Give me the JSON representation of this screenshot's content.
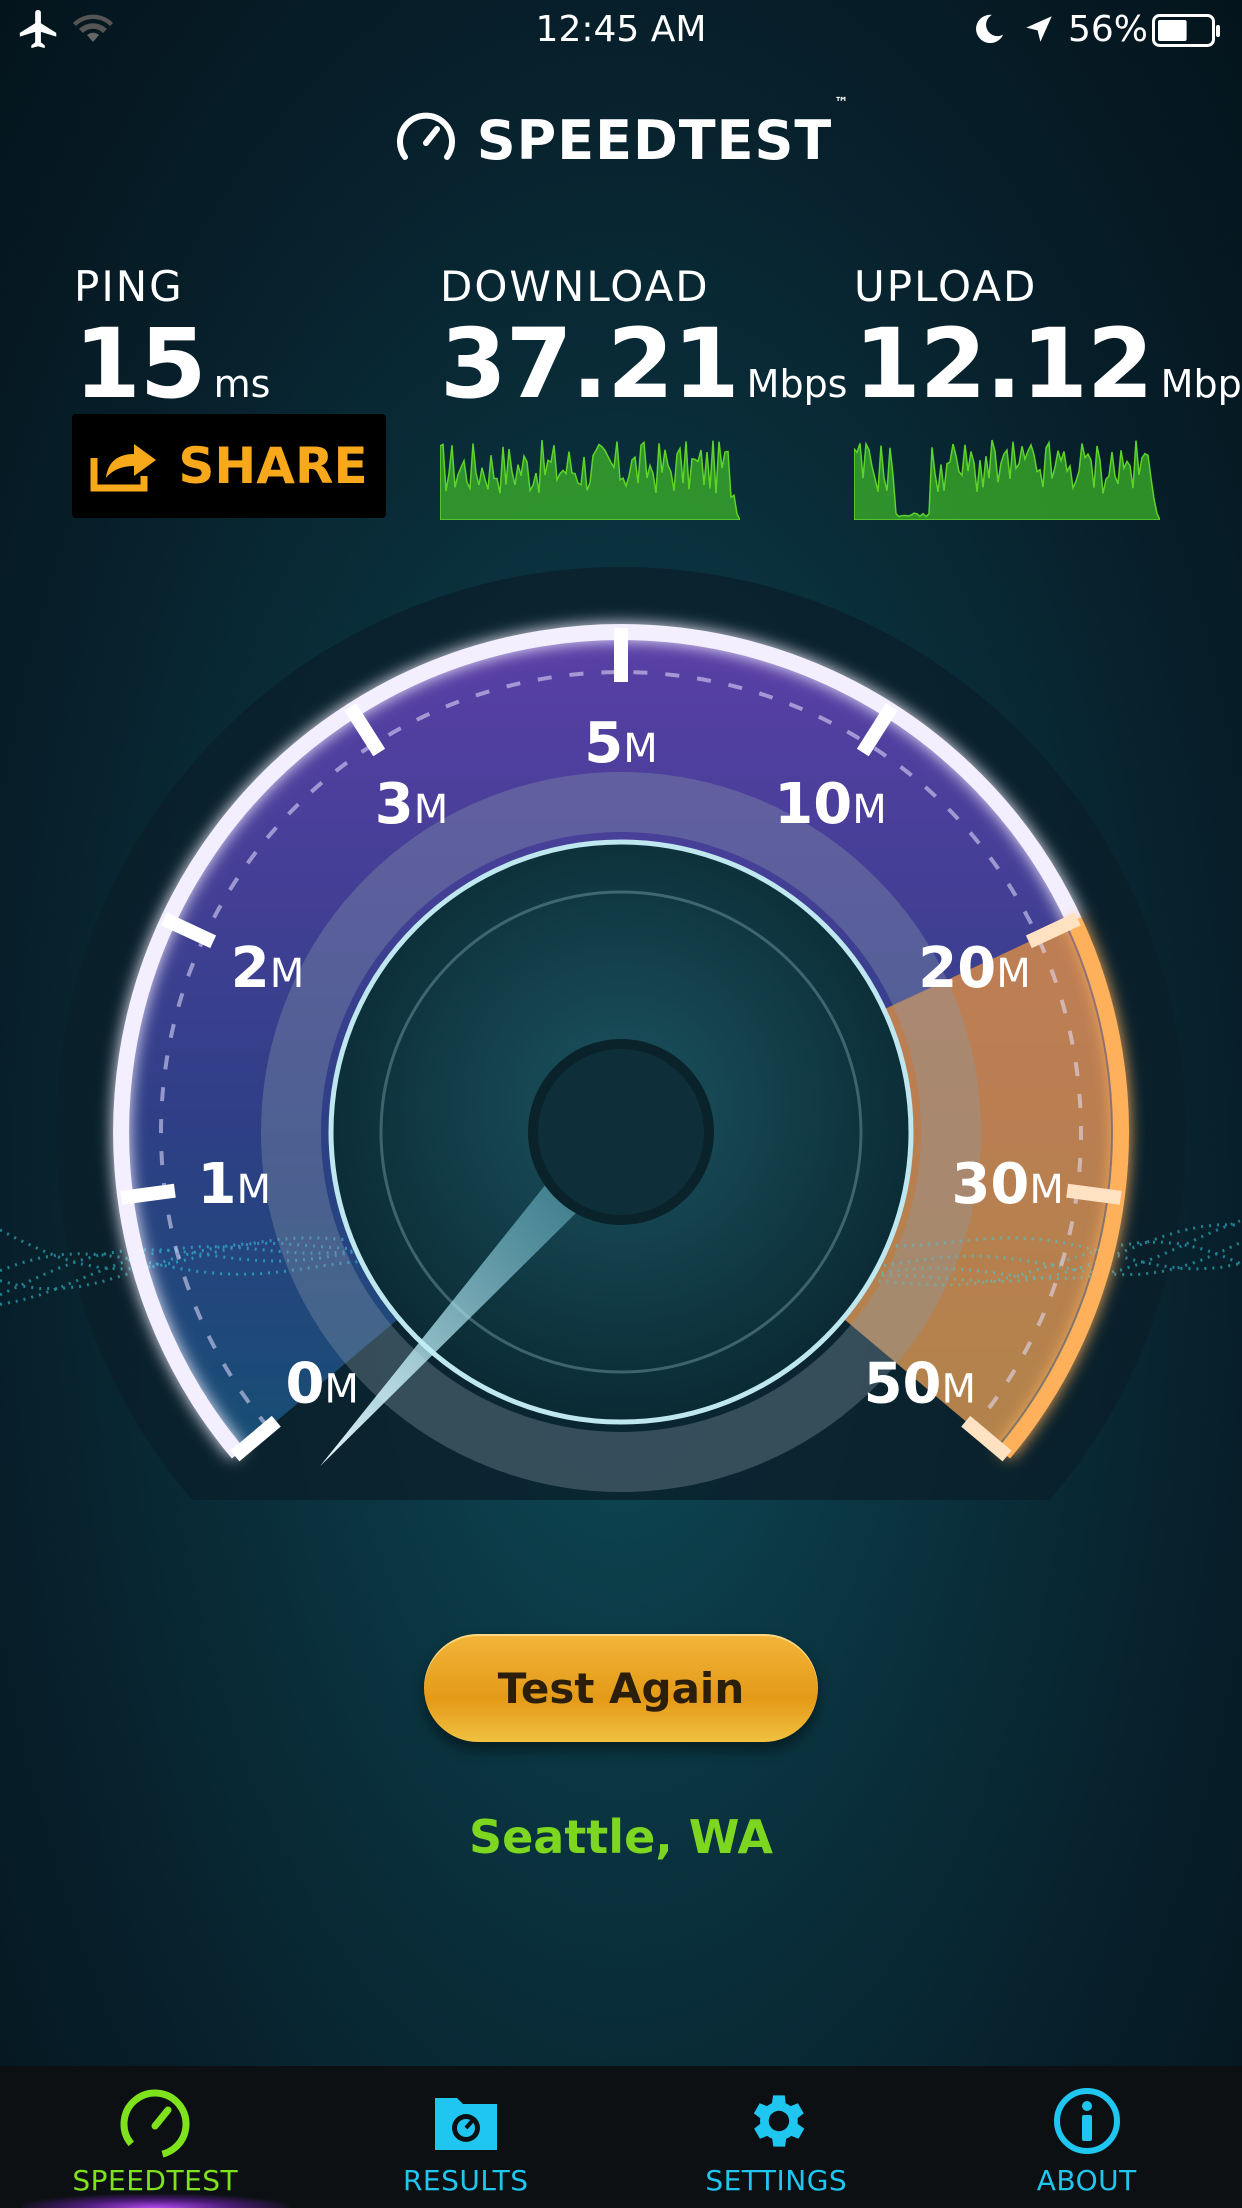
{
  "status_bar": {
    "time": "12:45 AM",
    "battery": "56%",
    "battery_level": 0.56,
    "icons": [
      "airplane-icon",
      "wifi-icon",
      "moon-icon",
      "location-arrow-icon",
      "battery-icon"
    ]
  },
  "header": {
    "title": "SPEEDTEST",
    "trademark": "™"
  },
  "metrics": {
    "ping": {
      "label": "PING",
      "value": "15",
      "unit": "ms"
    },
    "download": {
      "label": "DOWNLOAD",
      "value": "37.21",
      "unit": "Mbps"
    },
    "upload": {
      "label": "UPLOAD",
      "value": "12.12",
      "unit": "Mbps"
    }
  },
  "share": {
    "label": "SHARE"
  },
  "gauge": {
    "scale_labels": [
      {
        "num": "0",
        "unit": "M"
      },
      {
        "num": "1",
        "unit": "M"
      },
      {
        "num": "2",
        "unit": "M"
      },
      {
        "num": "3",
        "unit": "M"
      },
      {
        "num": "5",
        "unit": "M"
      },
      {
        "num": "10",
        "unit": "M"
      },
      {
        "num": "20",
        "unit": "M"
      },
      {
        "num": "30",
        "unit": "M"
      },
      {
        "num": "50",
        "unit": "M"
      }
    ],
    "needle_value": "0"
  },
  "actions": {
    "test_again": "Test Again"
  },
  "location": "Seattle, WA",
  "tabs": [
    {
      "label": "SPEEDTEST",
      "icon": "gauge-icon",
      "active": true
    },
    {
      "label": "RESULTS",
      "icon": "results-folder-icon",
      "active": false
    },
    {
      "label": "SETTINGS",
      "icon": "gear-icon",
      "active": false
    },
    {
      "label": "ABOUT",
      "icon": "info-icon",
      "active": false
    }
  ],
  "colors": {
    "accent_green": "#7dd61f",
    "accent_blue": "#1ec6f0",
    "share_orange": "#f7a91b",
    "button_gold": "#e9a21e",
    "gauge_orange": "#f59a3a"
  }
}
